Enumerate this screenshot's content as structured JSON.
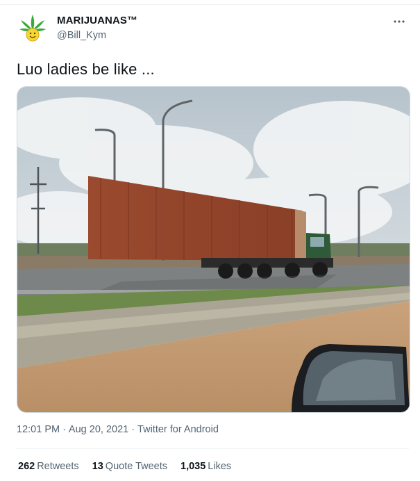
{
  "author": {
    "display_name": "MARIJUANAS™",
    "username": "@Bill_Kym",
    "avatar_icon": "cannabis-leaf-smiley-avatar"
  },
  "tweet": {
    "text": "Luo ladies be like ..."
  },
  "media": {
    "description_icon": "container-truck-photo"
  },
  "meta": {
    "time": "12:01 PM",
    "separator1": "·",
    "date": "Aug 20, 2021",
    "separator2": "·",
    "app": "Twitter for Android"
  },
  "stats": {
    "retweets_count": "262",
    "retweets_label": "Retweets",
    "quotes_count": "13",
    "quotes_label": "Quote Tweets",
    "likes_count": "1,035",
    "likes_label": "Likes"
  },
  "colors": {
    "text_primary": "#0f1419",
    "text_secondary": "#536471",
    "border": "#cfd9de"
  }
}
